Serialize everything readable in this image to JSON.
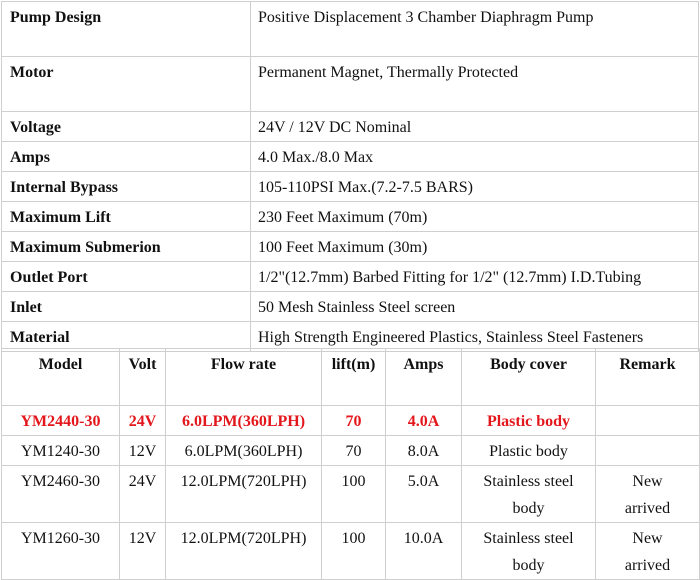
{
  "specs": [
    {
      "label": "Pump Design",
      "value": "Positive Displacement 3 Chamber Diaphragm Pump"
    },
    {
      "label": "Motor",
      "value": "Permanent Magnet, Thermally Protected"
    },
    {
      "label": "Voltage",
      "value": "24V / 12V DC Nominal"
    },
    {
      "label": "Amps",
      "value": "4.0 Max./8.0 Max"
    },
    {
      "label": "Internal Bypass",
      "value": "105-110PSI Max.(7.2-7.5 BARS)"
    },
    {
      "label": "Maximum Lift",
      "value": "230 Feet Maximum (70m)"
    },
    {
      "label": "Maximum Submerion",
      "value": "100 Feet Maximum (30m)"
    },
    {
      "label": "Outlet Port",
      "value": "1/2\"(12.7mm) Barbed Fitting for 1/2\" (12.7mm) I.D.Tubing"
    },
    {
      "label": "Inlet",
      "value": "50 Mesh Stainless Steel screen"
    },
    {
      "label": "Material",
      "value": "High Strength Engineered Plastics, Stainless Steel Fasteners"
    }
  ],
  "models": {
    "headers": [
      "Model",
      "Volt",
      "Flow rate",
      "lift(m)",
      "Amps",
      "Body cover",
      "Remark"
    ],
    "rows": [
      {
        "model": "YM2440-30",
        "volt": "24V",
        "flow": "6.0LPM(360LPH)",
        "lift": "70",
        "amps": "4.0A",
        "body": "Plastic body",
        "remark": ""
      },
      {
        "model": "YM1240-30",
        "volt": "12V",
        "flow": "6.0LPM(360LPH)",
        "lift": "70",
        "amps": "8.0A",
        "body": "Plastic body",
        "remark": ""
      },
      {
        "model": "YM2460-30",
        "volt": "24V",
        "flow": "12.0LPM(720LPH)",
        "lift": "100",
        "amps": "5.0A",
        "body": "Stainless steel body",
        "remark": "New arrived"
      },
      {
        "model": "YM1260-30",
        "volt": "12V",
        "flow": "12.0LPM(720LPH)",
        "lift": "100",
        "amps": "10.0A",
        "body": "Stainless steel body",
        "remark": "New arrived"
      }
    ]
  },
  "colors": {
    "highlight": "#e3161b",
    "border": "#cfcfcf"
  }
}
